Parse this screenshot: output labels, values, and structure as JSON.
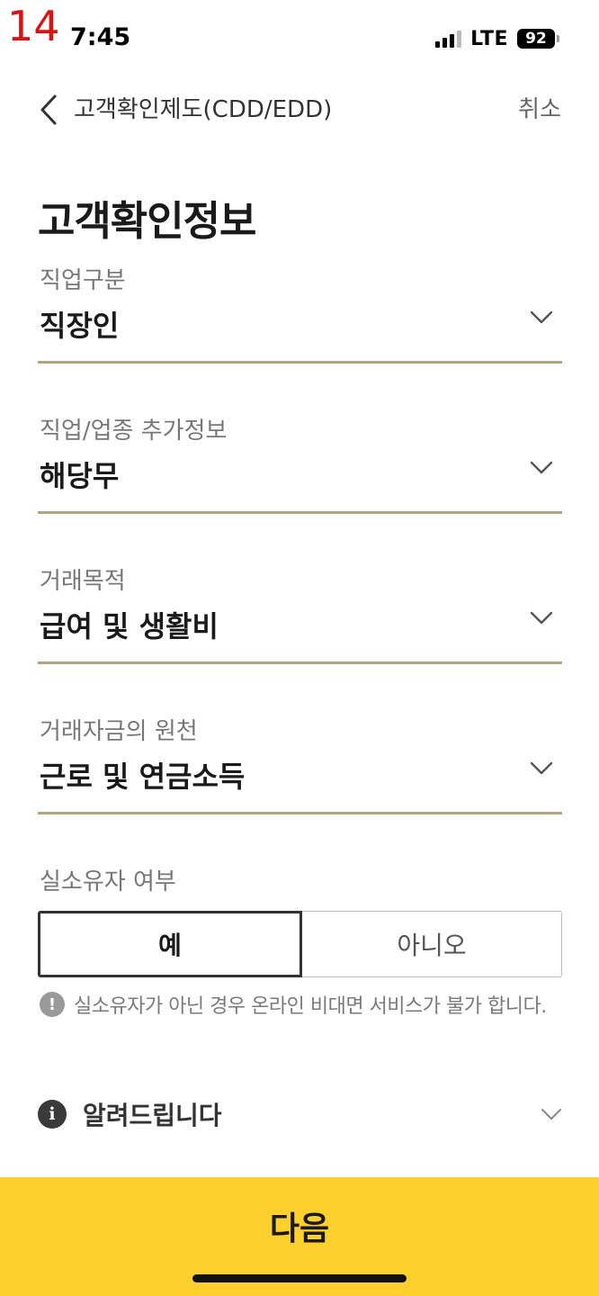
{
  "annotation": "14",
  "status_bar": {
    "time": "7:45",
    "network": "LTE",
    "battery": "92"
  },
  "header": {
    "title": "고객확인제도(CDD/EDD)",
    "cancel": "취소"
  },
  "page_title": "고객확인정보",
  "fields": [
    {
      "label": "직업구분",
      "value": "직장인"
    },
    {
      "label": "직업/업종 추가정보",
      "value": "해당무"
    },
    {
      "label": "거래목적",
      "value": "급여 및 생활비"
    },
    {
      "label": "거래자금의 원천",
      "value": "근로 및 연금소득"
    }
  ],
  "real_owner": {
    "label": "실소유자 여부",
    "options": [
      "예",
      "아니오"
    ],
    "selected": "예",
    "warning": "실소유자가 아닌 경우 온라인 비대면 서비스가 불가 합니다."
  },
  "notice": {
    "label": "알려드립니다"
  },
  "next_button": "다음",
  "colors": {
    "accent": "#fdd02d",
    "underline": "#b3a57f"
  },
  "icons": {
    "back": "chevron-left-icon",
    "dropdown": "chevron-down-icon",
    "warning": "exclamation-circle-icon",
    "info": "info-circle-icon"
  }
}
